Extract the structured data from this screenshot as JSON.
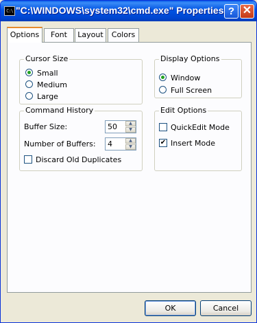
{
  "window": {
    "title": "\"C:\\WINDOWS\\system32\\cmd.exe\" Properties",
    "icon_text": "C:\\"
  },
  "title_buttons": {
    "help": "?",
    "close": "✕"
  },
  "tabs": [
    {
      "label": "Options",
      "active": true
    },
    {
      "label": "Font",
      "active": false
    },
    {
      "label": "Layout",
      "active": false
    },
    {
      "label": "Colors",
      "active": false
    }
  ],
  "cursor_size": {
    "legend": "Cursor Size",
    "options": [
      {
        "label": "Small",
        "selected": true
      },
      {
        "label": "Medium",
        "selected": false
      },
      {
        "label": "Large",
        "selected": false
      }
    ]
  },
  "display_options": {
    "legend": "Display Options",
    "options": [
      {
        "label": "Window",
        "selected": true
      },
      {
        "label": "Full Screen",
        "selected": false
      }
    ]
  },
  "command_history": {
    "legend": "Command History",
    "buffer_size_label": "Buffer Size:",
    "buffer_size_value": "50",
    "num_buffers_label": "Number of Buffers:",
    "num_buffers_value": "4",
    "discard_label": "Discard Old Duplicates",
    "discard_checked": false
  },
  "edit_options": {
    "legend": "Edit Options",
    "quickedit_label": "QuickEdit Mode",
    "quickedit_checked": false,
    "insert_label": "Insert Mode",
    "insert_checked": true,
    "check_mark": "✔"
  },
  "buttons": {
    "ok": "OK",
    "cancel": "Cancel"
  },
  "icons": {
    "spin_up": "▲",
    "spin_down": "▼"
  },
  "colors": {
    "title_bar": "#0054e3",
    "close_button": "#c43a16",
    "active_tab_accent": "#e68b2c",
    "radio_dot": "#21a121"
  }
}
